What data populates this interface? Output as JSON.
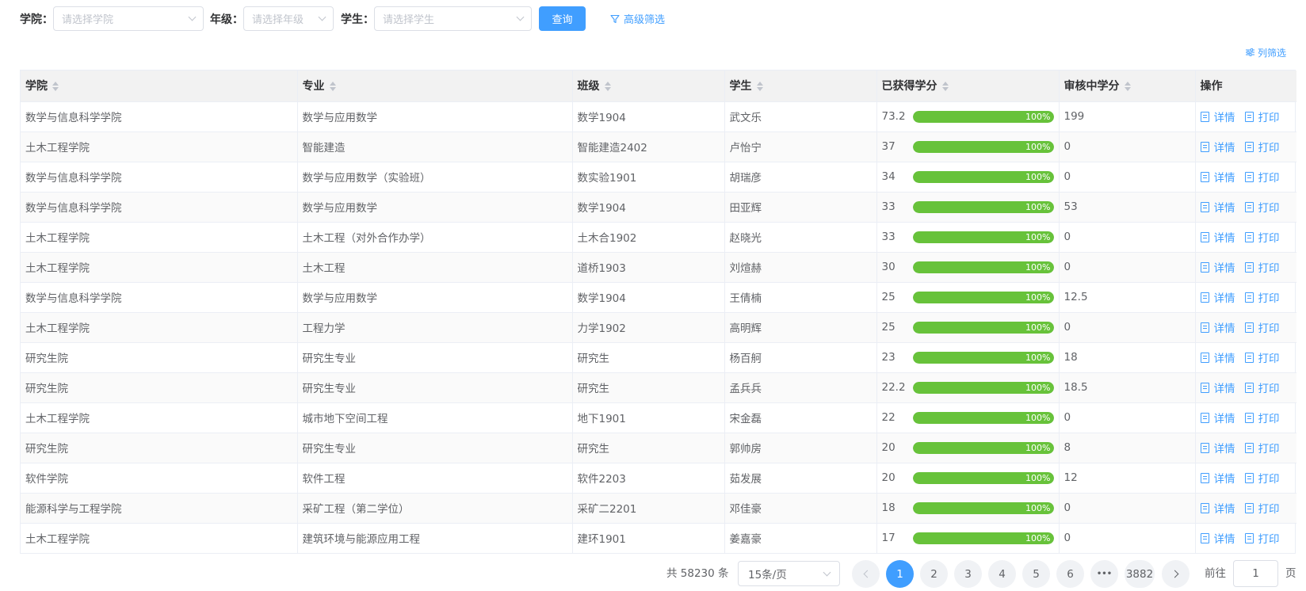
{
  "filters": {
    "college_label": "学院：",
    "college_placeholder": "请选择学院",
    "grade_label": "年级：",
    "grade_placeholder": "请选择年级",
    "student_label": "学生：",
    "student_placeholder": "请选择学生",
    "query_button": "查询",
    "advanced_filter": "高级筛选"
  },
  "column_filter": "列筛选",
  "table": {
    "headers": [
      "学院",
      "专业",
      "班级",
      "学生",
      "已获得学分",
      "审核中学分",
      "操作"
    ],
    "detail_label": "详情",
    "print_label": "打印",
    "rows": [
      {
        "college": "数学与信息科学学院",
        "major": "数学与应用数学",
        "class": "数学1904",
        "student": "武文乐",
        "credits": "73.2",
        "progress": "100%",
        "pending": "199"
      },
      {
        "college": "土木工程学院",
        "major": "智能建造",
        "class": "智能建造2402",
        "student": "卢怡宁",
        "credits": "37",
        "progress": "100%",
        "pending": "0"
      },
      {
        "college": "数学与信息科学学院",
        "major": "数学与应用数学（实验班）",
        "class": "数实验1901",
        "student": "胡瑞彦",
        "credits": "34",
        "progress": "100%",
        "pending": "0"
      },
      {
        "college": "数学与信息科学学院",
        "major": "数学与应用数学",
        "class": "数学1904",
        "student": "田亚辉",
        "credits": "33",
        "progress": "100%",
        "pending": "53"
      },
      {
        "college": "土木工程学院",
        "major": "土木工程（对外合作办学）",
        "class": "土木合1902",
        "student": "赵晓光",
        "credits": "33",
        "progress": "100%",
        "pending": "0"
      },
      {
        "college": "土木工程学院",
        "major": "土木工程",
        "class": "道桥1903",
        "student": "刘煊赫",
        "credits": "30",
        "progress": "100%",
        "pending": "0"
      },
      {
        "college": "数学与信息科学学院",
        "major": "数学与应用数学",
        "class": "数学1904",
        "student": "王倩楠",
        "credits": "25",
        "progress": "100%",
        "pending": "12.5"
      },
      {
        "college": "土木工程学院",
        "major": "工程力学",
        "class": "力学1902",
        "student": "高明辉",
        "credits": "25",
        "progress": "100%",
        "pending": "0"
      },
      {
        "college": "研究生院",
        "major": "研究生专业",
        "class": "研究生",
        "student": "杨百舸",
        "credits": "23",
        "progress": "100%",
        "pending": "18"
      },
      {
        "college": "研究生院",
        "major": "研究生专业",
        "class": "研究生",
        "student": "孟兵兵",
        "credits": "22.2",
        "progress": "100%",
        "pending": "18.5"
      },
      {
        "college": "土木工程学院",
        "major": "城市地下空间工程",
        "class": "地下1901",
        "student": "宋金磊",
        "credits": "22",
        "progress": "100%",
        "pending": "0"
      },
      {
        "college": "研究生院",
        "major": "研究生专业",
        "class": "研究生",
        "student": "郭帅房",
        "credits": "20",
        "progress": "100%",
        "pending": "8"
      },
      {
        "college": "软件学院",
        "major": "软件工程",
        "class": "软件2203",
        "student": "茹发展",
        "credits": "20",
        "progress": "100%",
        "pending": "12"
      },
      {
        "college": "能源科学与工程学院",
        "major": "采矿工程（第二学位）",
        "class": "采矿二2201",
        "student": "邓佳豪",
        "credits": "18",
        "progress": "100%",
        "pending": "0"
      },
      {
        "college": "土木工程学院",
        "major": "建筑环境与能源应用工程",
        "class": "建环1901",
        "student": "姜嘉豪",
        "credits": "17",
        "progress": "100%",
        "pending": "0"
      }
    ]
  },
  "pagination": {
    "total": "共 58230 条",
    "page_size": "15条/页",
    "pages": [
      "1",
      "2",
      "3",
      "4",
      "5",
      "6"
    ],
    "ellipsis": "•••",
    "last_page": "3882",
    "current_page": "1",
    "goto_prefix": "前往",
    "goto_value": "1",
    "goto_suffix": "页"
  },
  "colors": {
    "primary": "#409eff",
    "success": "#67c23a"
  }
}
